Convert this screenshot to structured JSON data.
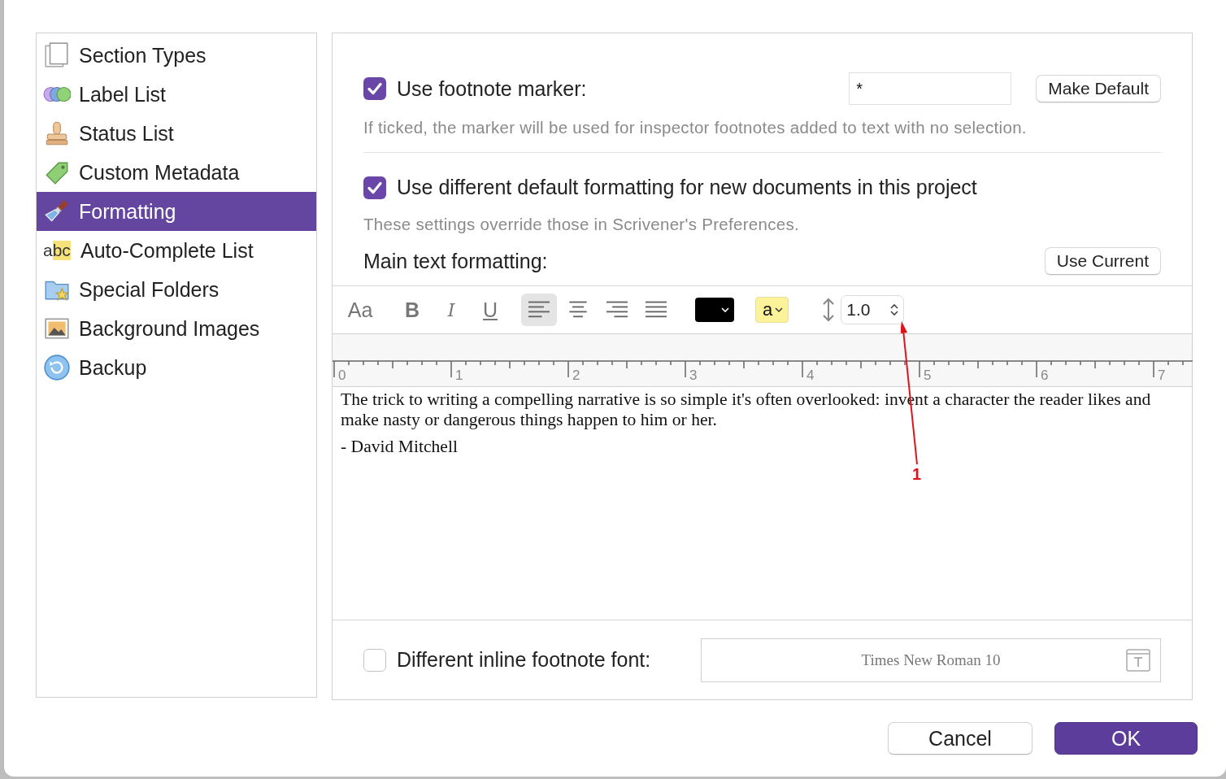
{
  "sidebar": {
    "items": [
      {
        "label": "Section Types",
        "kind": "pages",
        "selected": false
      },
      {
        "label": "Label List",
        "kind": "circles",
        "selected": false
      },
      {
        "label": "Status List",
        "kind": "stamp",
        "selected": false
      },
      {
        "label": "Custom Metadata",
        "kind": "tag",
        "selected": false
      },
      {
        "label": "Formatting",
        "kind": "brush",
        "selected": true
      },
      {
        "label": "Auto-Complete List",
        "kind": "abc",
        "icon_text": "abc",
        "selected": false
      },
      {
        "label": "Special Folders",
        "kind": "folder",
        "selected": false
      },
      {
        "label": "Background Images",
        "kind": "picture",
        "selected": false
      },
      {
        "label": "Backup",
        "kind": "backup",
        "selected": false
      }
    ]
  },
  "footnote_marker": {
    "label": "Use footnote marker:",
    "checked": true,
    "value": "*",
    "button": "Make Default",
    "hint": "If ticked, the marker will be used for inspector footnotes added to text with no selection."
  },
  "default_formatting": {
    "label": "Use different default formatting for new documents in this project",
    "checked": true,
    "hint": "These settings override those in Scrivener's Preferences.",
    "main_label": "Main text formatting:",
    "button": "Use Current"
  },
  "toolbar": {
    "font_button": "Aa",
    "bold": "B",
    "italic": "I",
    "underline": "U",
    "alignments": [
      {
        "kind": "left",
        "selected": true
      },
      {
        "kind": "center",
        "selected": false
      },
      {
        "kind": "right",
        "selected": false
      },
      {
        "kind": "justify",
        "selected": false
      }
    ],
    "highlight": "a",
    "line_spacing": "1.0"
  },
  "ruler": {
    "labels": [
      "0",
      "1",
      "2",
      "3",
      "4",
      "5",
      "6",
      "7"
    ]
  },
  "editor": {
    "paragraphs": [
      "The trick to writing a compelling narrative is so simple it's often overlooked: invent a character the reader likes and make nasty or dangerous things happen to him or her.",
      "- David Mitchell"
    ]
  },
  "inline_footnote": {
    "label": "Different inline footnote font:",
    "checked": false,
    "font": "Times New Roman 10"
  },
  "annotation": {
    "label": "1"
  },
  "buttons": [
    {
      "label": "Cancel",
      "kind": "default"
    },
    {
      "label": "OK",
      "kind": "primary"
    }
  ]
}
